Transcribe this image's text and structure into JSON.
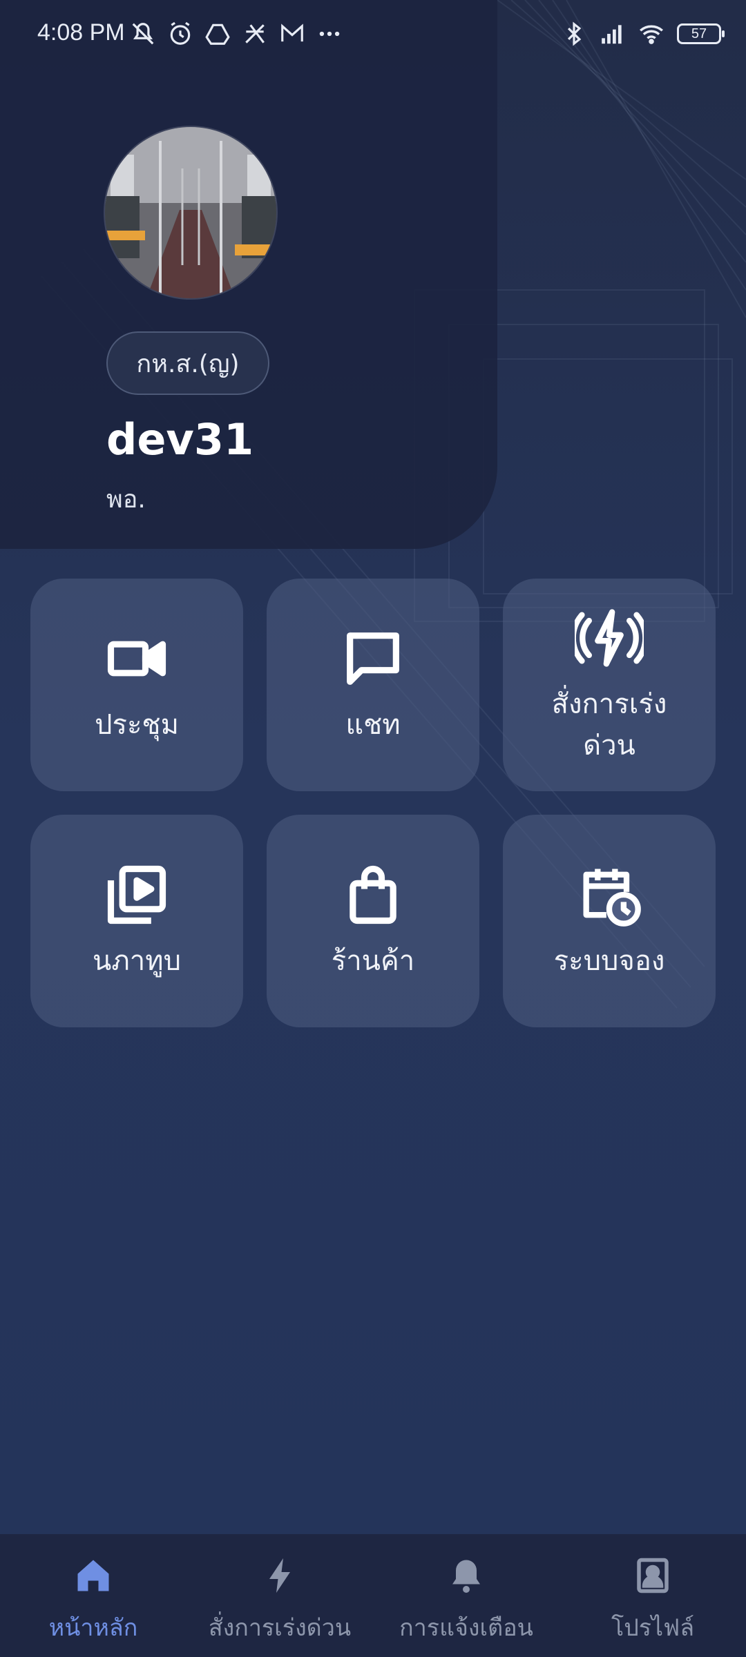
{
  "status_bar": {
    "time": "4:08 PM",
    "battery": "57",
    "left_icons": [
      "mute-icon",
      "alarm-icon",
      "drive-icon",
      "app-icon",
      "mail-icon",
      "more-dots-icon"
    ],
    "right_icons": [
      "bluetooth-icon",
      "signal-icon",
      "wifi-icon",
      "battery-icon"
    ]
  },
  "profile": {
    "rank": "กห.ส.(ญ)",
    "username": "dev31",
    "position": "พอ."
  },
  "menu": {
    "meeting": "ประชุม",
    "chat": "แชท",
    "urgent_order": "สั่งการเร่งด่วน",
    "gallery": "นภาทูบ",
    "shop": "ร้านค้า",
    "booking": "ระบบจอง"
  },
  "nav": {
    "home": "หน้าหลัก",
    "urgent": "สั่งการเร่งด่วน",
    "notifications": "การแจ้งเตือน",
    "profile": "โปรไฟล์",
    "active": "home",
    "active_color": "#6f8fe3",
    "inactive_color": "#8d96ab"
  }
}
